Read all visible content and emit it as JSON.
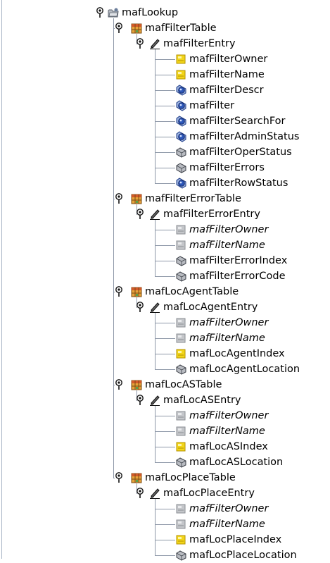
{
  "tree": [
    {
      "label": "mafLookup",
      "type": "folder",
      "level": 0,
      "expanded": true
    },
    {
      "label": "mafFilterTable",
      "type": "table",
      "level": 1,
      "expanded": true
    },
    {
      "label": "mafFilterEntry",
      "type": "entry",
      "level": 2,
      "expanded": true
    },
    {
      "label": "mafFilterOwner",
      "type": "index",
      "level": 3
    },
    {
      "label": "mafFilterName",
      "type": "index",
      "level": 3
    },
    {
      "label": "mafFilterDescr",
      "type": "rw",
      "level": 3
    },
    {
      "label": "mafFilter",
      "type": "rw",
      "level": 3
    },
    {
      "label": "mafFilterSearchFor",
      "type": "rw",
      "level": 3
    },
    {
      "label": "mafFilterAdminStatus",
      "type": "rw",
      "level": 3
    },
    {
      "label": "mafFilterOperStatus",
      "type": "ro",
      "level": 3
    },
    {
      "label": "mafFilterErrors",
      "type": "ro",
      "level": 3
    },
    {
      "label": "mafFilterRowStatus",
      "type": "rw",
      "level": 3
    },
    {
      "label": "mafFilterErrorTable",
      "type": "table",
      "level": 1,
      "expanded": true
    },
    {
      "label": "mafFilterErrorEntry",
      "type": "entry",
      "level": 2,
      "expanded": true
    },
    {
      "label": "mafFilterOwner",
      "type": "ext",
      "level": 3,
      "italic": true
    },
    {
      "label": "mafFilterName",
      "type": "ext",
      "level": 3,
      "italic": true
    },
    {
      "label": "mafFilterErrorIndex",
      "type": "ro",
      "level": 3
    },
    {
      "label": "mafFilterErrorCode",
      "type": "ro",
      "level": 3
    },
    {
      "label": "mafLocAgentTable",
      "type": "table",
      "level": 1,
      "expanded": true
    },
    {
      "label": "mafLocAgentEntry",
      "type": "entry",
      "level": 2,
      "expanded": true
    },
    {
      "label": "mafFilterOwner",
      "type": "ext",
      "level": 3,
      "italic": true
    },
    {
      "label": "mafFilterName",
      "type": "ext",
      "level": 3,
      "italic": true
    },
    {
      "label": "mafLocAgentIndex",
      "type": "index",
      "level": 3
    },
    {
      "label": "mafLocAgentLocation",
      "type": "ro",
      "level": 3
    },
    {
      "label": "mafLocASTable",
      "type": "table",
      "level": 1,
      "expanded": true
    },
    {
      "label": "mafLocASEntry",
      "type": "entry",
      "level": 2,
      "expanded": true
    },
    {
      "label": "mafFilterOwner",
      "type": "ext",
      "level": 3,
      "italic": true
    },
    {
      "label": "mafFilterName",
      "type": "ext",
      "level": 3,
      "italic": true
    },
    {
      "label": "mafLocASIndex",
      "type": "index",
      "level": 3
    },
    {
      "label": "mafLocASLocation",
      "type": "ro",
      "level": 3
    },
    {
      "label": "mafLocPlaceTable",
      "type": "table",
      "level": 1,
      "expanded": true
    },
    {
      "label": "mafLocPlaceEntry",
      "type": "entry",
      "level": 2,
      "expanded": true
    },
    {
      "label": "mafFilterOwner",
      "type": "ext",
      "level": 3,
      "italic": true
    },
    {
      "label": "mafFilterName",
      "type": "ext",
      "level": 3,
      "italic": true
    },
    {
      "label": "mafLocPlaceIndex",
      "type": "index",
      "level": 3
    },
    {
      "label": "mafLocPlaceLocation",
      "type": "ro",
      "level": 3
    }
  ],
  "icons": {
    "folder": "folder-icon",
    "table": "table-icon",
    "entry": "pencil-icon",
    "index": "index-key-icon",
    "rw": "read-write-column-icon",
    "ro": "read-only-column-icon",
    "ext": "external-index-icon",
    "toggle": "expand-toggle-icon"
  },
  "colors": {
    "index": "#f2d51a",
    "rw": "#2d57b8",
    "ro": "#b9bcc2",
    "ext": "#c4c6ca",
    "connector": "#8e98a8"
  }
}
